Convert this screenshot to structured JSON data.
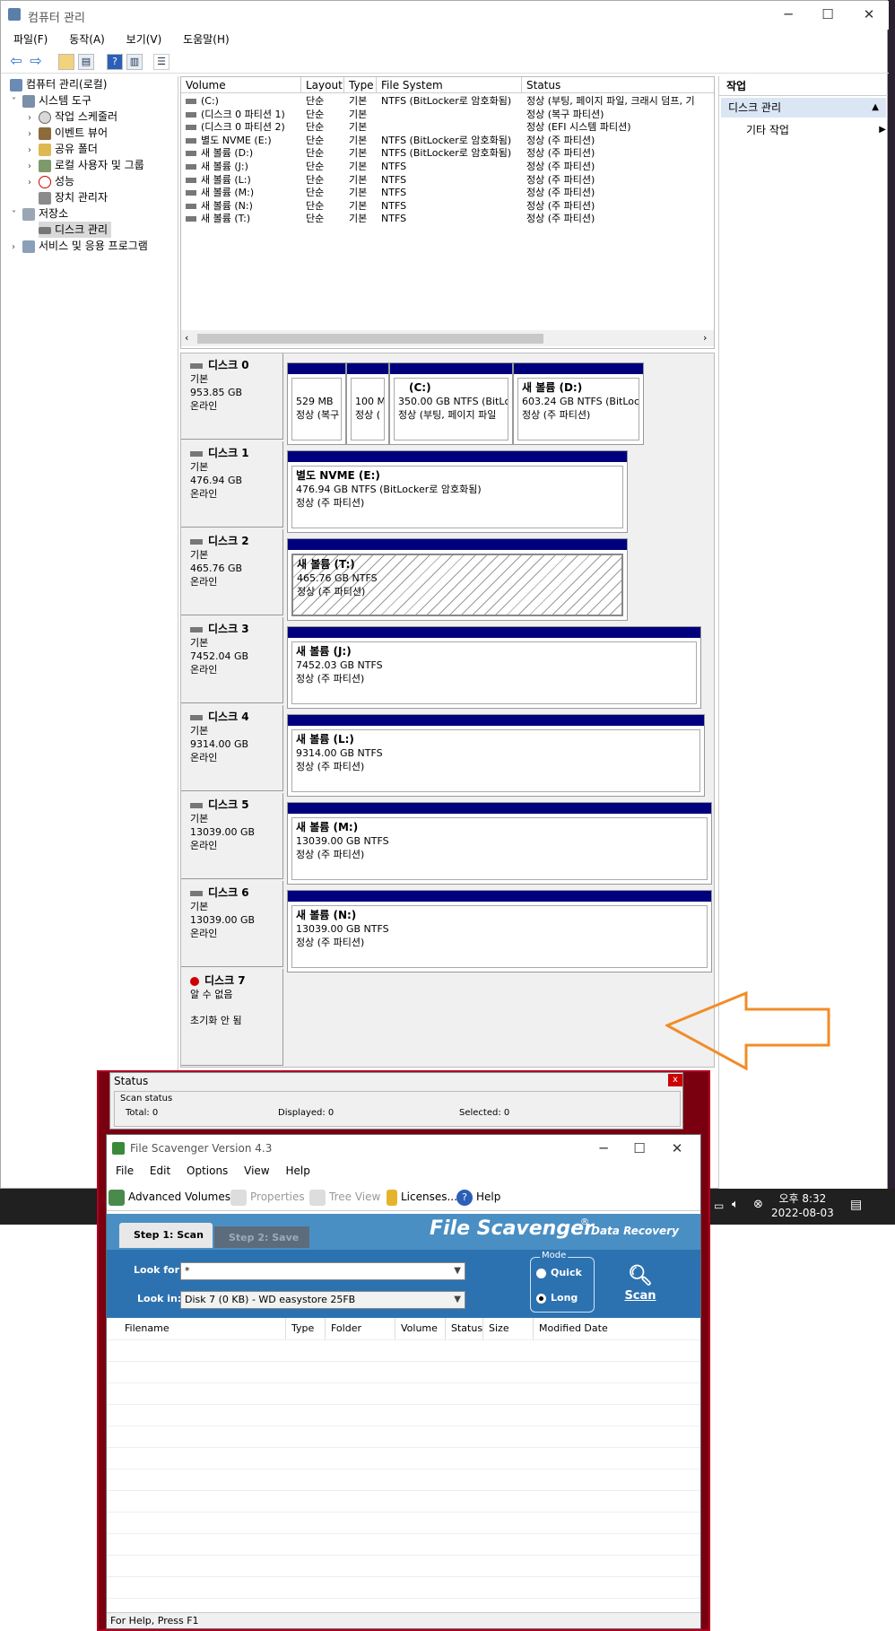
{
  "computer_management": {
    "title": "컴퓨터 관리",
    "menu": [
      "파일(F)",
      "동작(A)",
      "보기(V)",
      "도움말(H)"
    ],
    "tree": {
      "root": "컴퓨터 관리(로컬)",
      "system_tools": "시스템 도구",
      "task_scheduler": "작업 스케줄러",
      "event_viewer": "이벤트 뷰어",
      "shared_folders": "공유 폴더",
      "local_users": "로컬 사용자 및 그룹",
      "performance": "성능",
      "device_manager": "장치 관리자",
      "storage": "저장소",
      "disk_management": "디스크 관리",
      "services": "서비스 및 응용 프로그램"
    },
    "columns": [
      "Volume",
      "Layout",
      "Type",
      "File System",
      "Status"
    ],
    "volumes": [
      {
        "volume": "(C:)",
        "layout": "단순",
        "type": "기본",
        "fs": "NTFS (BitLocker로 암호화됨)",
        "status": "정상 (부팅, 페이지 파일, 크래시 덤프, 기"
      },
      {
        "volume": "(디스크 0 파티션 1)",
        "layout": "단순",
        "type": "기본",
        "fs": "",
        "status": "정상 (복구 파티션)"
      },
      {
        "volume": "(디스크 0 파티션 2)",
        "layout": "단순",
        "type": "기본",
        "fs": "",
        "status": "정상 (EFI 시스템 파티션)"
      },
      {
        "volume": "별도 NVME (E:)",
        "layout": "단순",
        "type": "기본",
        "fs": "NTFS (BitLocker로 암호화됨)",
        "status": "정상 (주 파티션)"
      },
      {
        "volume": "새 볼륨 (D:)",
        "layout": "단순",
        "type": "기본",
        "fs": "NTFS (BitLocker로 암호화됨)",
        "status": "정상 (주 파티션)"
      },
      {
        "volume": "새 볼륨 (J:)",
        "layout": "단순",
        "type": "기본",
        "fs": "NTFS",
        "status": "정상 (주 파티션)"
      },
      {
        "volume": "새 볼륨 (L:)",
        "layout": "단순",
        "type": "기본",
        "fs": "NTFS",
        "status": "정상 (주 파티션)"
      },
      {
        "volume": "새 볼륨 (M:)",
        "layout": "단순",
        "type": "기본",
        "fs": "NTFS",
        "status": "정상 (주 파티션)"
      },
      {
        "volume": "새 볼륨 (N:)",
        "layout": "단순",
        "type": "기본",
        "fs": "NTFS",
        "status": "정상 (주 파티션)"
      },
      {
        "volume": "새 볼륨 (T:)",
        "layout": "단순",
        "type": "기본",
        "fs": "NTFS",
        "status": "정상 (주 파티션)"
      }
    ],
    "disks": [
      {
        "name": "디스크 0",
        "type": "기본",
        "size": "953.85 GB",
        "state": "온라인"
      },
      {
        "name": "디스크 1",
        "type": "기본",
        "size": "476.94 GB",
        "state": "온라인"
      },
      {
        "name": "디스크 2",
        "type": "기본",
        "size": "465.76 GB",
        "state": "온라인"
      },
      {
        "name": "디스크 3",
        "type": "기본",
        "size": "7452.04 GB",
        "state": "온라인"
      },
      {
        "name": "디스크 4",
        "type": "기본",
        "size": "9314.00 GB",
        "state": "온라인"
      },
      {
        "name": "디스크 5",
        "type": "기본",
        "size": "13039.00 GB",
        "state": "온라인"
      },
      {
        "name": "디스크 6",
        "type": "기본",
        "size": "13039.00 GB",
        "state": "온라인"
      },
      {
        "name": "디스크 7",
        "type": "알 수 없음",
        "size": "",
        "state": "초기화 안 됨"
      }
    ],
    "partitions": {
      "d0p1": {
        "l1": "529 MB",
        "l2": "정상 (복구"
      },
      "d0p2": {
        "l1": "100 M",
        "l2": "정상 ("
      },
      "d0c": {
        "name": "(C:)",
        "l1": "350.00 GB NTFS (BitLc",
        "l2": "정상 (부팅, 페이지 파일"
      },
      "d0d": {
        "name": "새 볼륨  (D:)",
        "l1": "603.24 GB NTFS (BitLoc",
        "l2": "정상 (주 파티션)"
      },
      "d1": {
        "name": "별도 NVME  (E:)",
        "l1": "476.94 GB NTFS (BitLocker로 암호화됨)",
        "l2": "정상 (주 파티션)"
      },
      "d2": {
        "name": "새 볼륨  (T:)",
        "l1": "465.76 GB NTFS",
        "l2": "정상 (주 파티션)"
      },
      "d3": {
        "name": "새 볼륨  (J:)",
        "l1": "7452.03 GB NTFS",
        "l2": "정상 (주 파티션)"
      },
      "d4": {
        "name": "새 볼륨  (L:)",
        "l1": "9314.00 GB NTFS",
        "l2": "정상 (주 파티션)"
      },
      "d5": {
        "name": "새 볼륨  (M:)",
        "l1": "13039.00 GB NTFS",
        "l2": "정상 (주 파티션)"
      },
      "d6": {
        "name": "새 볼륨  (N:)",
        "l1": "13039.00 GB NTFS",
        "l2": "정상 (주 파티션)"
      }
    },
    "actions": {
      "header": "작업",
      "section": "디스크 관리",
      "other": "기타 작업"
    }
  },
  "taskbar": {
    "time": "오후 8:32",
    "date": "2022-08-03"
  },
  "status_window": {
    "title": "Status",
    "group": "Scan status",
    "total": "Total: 0",
    "displayed": "Displayed: 0",
    "selected": "Selected: 0",
    "close": "x"
  },
  "file_scavenger": {
    "title": "File Scavenger Version 4.3",
    "menu": [
      "File",
      "Edit",
      "Options",
      "View",
      "Help"
    ],
    "toolbar": {
      "advanced": "Advanced Volumes...",
      "properties": "Properties",
      "tree_view": "Tree View",
      "licenses": "Licenses...",
      "help": "Help"
    },
    "step1": "Step 1: Scan",
    "step2": "Step 2: Save",
    "brand": "File Scavenger",
    "brand_sub": "Data Recovery",
    "look_for_label": "Look for:",
    "look_for_value": "*",
    "look_in_label": "Look in:",
    "look_in_value": "Disk 7 (0 KB) - WD      easystore 25FB",
    "mode_label": "Mode",
    "mode_quick": "Quick",
    "mode_long": "Long",
    "scan_label": "Scan",
    "columns": [
      "Filename",
      "Type",
      "Folder",
      "Volume",
      "Status",
      "Size",
      "Modified Date"
    ],
    "status_bar": "For Help, Press F1"
  },
  "colors": {
    "partition_bar": "#00007f",
    "scavenger_blue": "#2d72b0",
    "arrow": "#f28c28",
    "frame_red": "#7a0010"
  }
}
